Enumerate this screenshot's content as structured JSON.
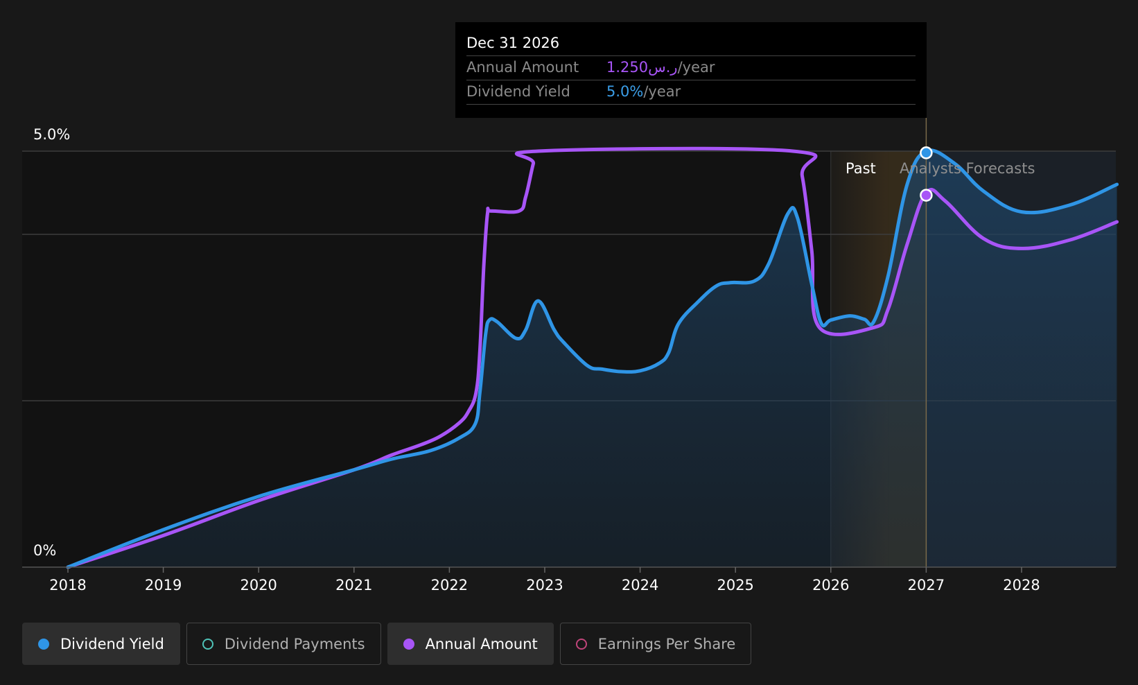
{
  "tooltip": {
    "date": "Dec 31 2026",
    "rows": [
      {
        "name": "Annual Amount",
        "value": "1.250ر.س",
        "unit": "/year",
        "color": "#a855f7"
      },
      {
        "name": "Dividend Yield",
        "value": "5.0%",
        "unit": "/year",
        "color": "#3b9ee8"
      }
    ]
  },
  "regions": {
    "past_label": "Past",
    "forecast_label": "Analysts Forecasts"
  },
  "legend": [
    {
      "label": "Dividend Yield",
      "color": "#2f95e6",
      "active": true,
      "filled": true
    },
    {
      "label": "Dividend Payments",
      "color": "#4fc3b8",
      "active": false,
      "filled": false
    },
    {
      "label": "Annual Amount",
      "color": "#a855f7",
      "active": true,
      "filled": true
    },
    {
      "label": "Earnings Per Share",
      "color": "#c0457a",
      "active": false,
      "filled": false
    }
  ],
  "chart_data": {
    "type": "line",
    "x_ticks": [
      "2018",
      "2019",
      "2020",
      "2021",
      "2022",
      "2023",
      "2024",
      "2025",
      "2026",
      "2027",
      "2028"
    ],
    "y_tick_labels": [
      "0%",
      "5.0%"
    ],
    "ylim": [
      0,
      5.0
    ],
    "xlim": [
      2017.53,
      2029.0
    ],
    "past_range": [
      2026.0,
      2026.6
    ],
    "forecast_start": 2026.6,
    "tooltip_x": 2027.0,
    "series": [
      {
        "name": "Dividend Yield",
        "color": "#2f95e6",
        "points": [
          [
            2018.0,
            0.0
          ],
          [
            2019.0,
            0.45
          ],
          [
            2020.0,
            0.85
          ],
          [
            2021.0,
            1.17
          ],
          [
            2021.4,
            1.3
          ],
          [
            2021.8,
            1.4
          ],
          [
            2022.1,
            1.55
          ],
          [
            2022.27,
            1.72
          ],
          [
            2022.32,
            2.1
          ],
          [
            2022.38,
            2.8
          ],
          [
            2022.42,
            2.97
          ],
          [
            2022.5,
            2.95
          ],
          [
            2022.7,
            2.75
          ],
          [
            2022.8,
            2.85
          ],
          [
            2022.93,
            3.2
          ],
          [
            2023.1,
            2.85
          ],
          [
            2023.2,
            2.7
          ],
          [
            2023.45,
            2.42
          ],
          [
            2023.6,
            2.38
          ],
          [
            2023.8,
            2.35
          ],
          [
            2024.0,
            2.36
          ],
          [
            2024.2,
            2.45
          ],
          [
            2024.3,
            2.58
          ],
          [
            2024.4,
            2.92
          ],
          [
            2024.6,
            3.18
          ],
          [
            2024.8,
            3.38
          ],
          [
            2024.95,
            3.42
          ],
          [
            2025.2,
            3.44
          ],
          [
            2025.35,
            3.65
          ],
          [
            2025.55,
            4.25
          ],
          [
            2025.65,
            4.2
          ],
          [
            2025.8,
            3.4
          ],
          [
            2025.9,
            2.93
          ],
          [
            2026.0,
            2.97
          ],
          [
            2026.2,
            3.02
          ],
          [
            2026.35,
            2.98
          ],
          [
            2026.45,
            2.95
          ],
          [
            2026.6,
            3.5
          ],
          [
            2026.8,
            4.6
          ],
          [
            2027.0,
            5.0
          ],
          [
            2027.3,
            4.85
          ],
          [
            2027.6,
            4.52
          ],
          [
            2028.0,
            4.27
          ],
          [
            2028.5,
            4.35
          ],
          [
            2029.0,
            4.6
          ]
        ]
      },
      {
        "name": "Annual Amount",
        "color": "#a855f7",
        "points": [
          [
            2018.0,
            0.0
          ],
          [
            2019.0,
            0.38
          ],
          [
            2020.0,
            0.8
          ],
          [
            2021.0,
            1.17
          ],
          [
            2021.4,
            1.35
          ],
          [
            2021.7,
            1.47
          ],
          [
            2021.9,
            1.57
          ],
          [
            2022.1,
            1.73
          ],
          [
            2022.2,
            1.87
          ],
          [
            2022.28,
            2.1
          ],
          [
            2022.32,
            2.6
          ],
          [
            2022.36,
            3.6
          ],
          [
            2022.4,
            4.25
          ],
          [
            2022.44,
            4.28
          ],
          [
            2022.73,
            4.28
          ],
          [
            2022.8,
            4.45
          ],
          [
            2022.88,
            4.85
          ],
          [
            2022.93,
            5.0
          ],
          [
            2025.6,
            5.0
          ],
          [
            2025.7,
            4.7
          ],
          [
            2025.8,
            3.8
          ],
          [
            2025.88,
            2.88
          ],
          [
            2026.45,
            2.88
          ],
          [
            2026.6,
            3.1
          ],
          [
            2026.8,
            3.88
          ],
          [
            2027.0,
            4.5
          ],
          [
            2027.2,
            4.4
          ],
          [
            2027.6,
            3.95
          ],
          [
            2028.0,
            3.83
          ],
          [
            2028.5,
            3.93
          ],
          [
            2029.0,
            4.15
          ]
        ]
      }
    ],
    "markers": [
      {
        "series": "Dividend Yield",
        "x": 2027.0,
        "y": 4.98
      },
      {
        "series": "Annual Amount",
        "x": 2027.0,
        "y": 4.47
      }
    ]
  }
}
